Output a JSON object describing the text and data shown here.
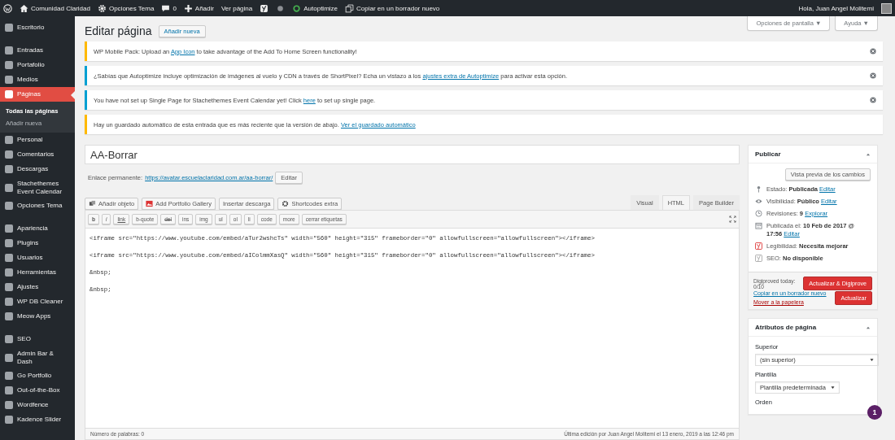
{
  "admin_bar": {
    "items": [
      {
        "kind": "logo"
      },
      {
        "kind": "home",
        "label": "Comunidad Claridad"
      },
      {
        "kind": "settings",
        "label": "Opciones Tema"
      },
      {
        "kind": "comments",
        "label": "0"
      },
      {
        "kind": "new",
        "label": "Añadir"
      },
      {
        "kind": "link",
        "label": "Ver página"
      },
      {
        "kind": "seo"
      },
      {
        "kind": "dot"
      },
      {
        "kind": "ring",
        "label": "Autoptimize"
      },
      {
        "kind": "copy",
        "label": "Copiar en un borrador nuevo"
      }
    ],
    "user": "Hola, Juan Angel Molitemi"
  },
  "sidebar": {
    "groups": [
      [
        {
          "label": "Escritorio",
          "selected": false
        }
      ],
      [
        {
          "label": "Entradas",
          "selected": false
        },
        {
          "label": "Portafolio",
          "selected": false
        },
        {
          "label": "Medios",
          "selected": false
        },
        {
          "label": "Páginas",
          "selected": true,
          "children": [
            {
              "label": "Todas las páginas",
              "selected": true
            },
            {
              "label": "Añadir nueva",
              "selected": false
            }
          ]
        },
        {
          "label": "Personal",
          "selected": false
        },
        {
          "label": "Comentarios",
          "selected": false
        },
        {
          "label": "Descargas",
          "selected": false
        },
        {
          "label": "Stachethemes Event Calendar",
          "selected": false
        },
        {
          "label": "Opciones Tema",
          "selected": false
        }
      ],
      [
        {
          "label": "Apariencia",
          "selected": false
        },
        {
          "label": "Plugins",
          "selected": false
        },
        {
          "label": "Usuarios",
          "selected": false
        },
        {
          "label": "Herramientas",
          "selected": false
        },
        {
          "label": "Ajustes",
          "selected": false
        },
        {
          "label": "WP DB Cleaner",
          "selected": false
        },
        {
          "label": "Meow Apps",
          "selected": false
        }
      ],
      [
        {
          "label": "SEO",
          "selected": false
        },
        {
          "label": "Admin Bar & Dash",
          "selected": false
        },
        {
          "label": "Go Portfolio",
          "selected": false
        },
        {
          "label": "Out-of-the-Box",
          "selected": false
        },
        {
          "label": "Wordfence",
          "selected": false
        },
        {
          "label": "Kadence Slider",
          "selected": false
        }
      ]
    ]
  },
  "header": {
    "title": "Editar página",
    "add_button": "Añadir nueva",
    "screen_options": "Opciones de pantalla ▼",
    "help": "Ayuda ▼"
  },
  "notices": [
    {
      "color": "#ffb900",
      "text_before": "WP Mobile Pack: Upload an ",
      "link": "App Icon",
      "text_after": " to take advantage of the Add To Home Screen functionality!",
      "dismissible": true
    },
    {
      "color": "#00a0d2",
      "text_before": "¿Sabías que Autoptimize incluye optimización de imágenes al vuelo y CDN a través de ShortPixel? Echa un vistazo a los ",
      "link": "ajustes extra de Autoptimize",
      "text_after": " para activar esta opción.",
      "dismissible": true
    },
    {
      "color": "#00a0d2",
      "text_before": "You have not set up Single Page for Stachethemes Event Calendar yet! Click ",
      "link": "here",
      "text_after": " to set up single page.",
      "dismissible": true
    },
    {
      "color": "#ffb900",
      "text_before": "Hay un guardado automático de esta entrada que es más reciente que la versión de abajo. ",
      "link": "Ver el guardado automático",
      "dismissible": false
    }
  ],
  "editor": {
    "title": "AA-Borrar",
    "permalink_label": "Enlace permanente:",
    "permalink": "https://avatar.escuelaclaridad.com.ar/aa-borrar/",
    "permalink_edit": "Editar",
    "media_buttons": [
      {
        "kind": "media",
        "label": "Añadir objeto"
      },
      {
        "kind": "gallery",
        "label": "Add Portfolio Gallery"
      },
      {
        "kind": "plain",
        "label": "Insertar descarga"
      },
      {
        "kind": "shortcodes",
        "label": "Shortcodes extra"
      }
    ],
    "tabs": [
      {
        "label": "Visual",
        "selected": false
      },
      {
        "label": "HTML",
        "selected": true
      },
      {
        "label": "Page Builder",
        "selected": false
      }
    ],
    "quicktags": [
      {
        "label": "b",
        "kind": "bold"
      },
      {
        "label": "i",
        "kind": "italic"
      },
      {
        "label": "link",
        "kind": "link"
      },
      {
        "label": "b-quote",
        "kind": "plain"
      },
      {
        "label": "del",
        "kind": "strike"
      },
      {
        "label": "ins",
        "kind": "plain"
      },
      {
        "label": "img",
        "kind": "plain"
      },
      {
        "label": "ul",
        "kind": "plain"
      },
      {
        "label": "ol",
        "kind": "plain"
      },
      {
        "label": "li",
        "kind": "plain"
      },
      {
        "label": "code",
        "kind": "plain"
      },
      {
        "label": "more",
        "kind": "plain"
      },
      {
        "label": "cerrar etiquetas",
        "kind": "plain"
      }
    ],
    "content": [
      "<iframe src=\"https://www.youtube.com/embed/aTur2wshcTs\" width=\"560\" height=\"315\" frameborder=\"0\" allowfullscreen=\"allowfullscreen\"></iframe>",
      "<iframe src=\"https://www.youtube.com/embed/aIColmmXasQ\" width=\"560\" height=\"315\" frameborder=\"0\" allowfullscreen=\"allowfullscreen\"></iframe>",
      "&nbsp;",
      "&nbsp;"
    ],
    "word_count": "Número de palabras: 0",
    "last_edit": "Última edición por Juan Angel Molitemi el 13 enero, 2019 a las 12:46 pm"
  },
  "publish": {
    "title": "Publicar",
    "preview": "Vista previa de los cambios",
    "rows": [
      {
        "kind": "status",
        "text": "Estado: **Publicada**",
        "link": "Editar"
      },
      {
        "kind": "visibility",
        "text": "Visibilidad: **Público**",
        "link": "Editar"
      },
      {
        "kind": "revisions",
        "text": "Revisiones: **9**",
        "link": "Explorar"
      },
      {
        "kind": "date",
        "text": "Publicada el: **10 Feb de 2017 @ 17:56**",
        "link": "Editar"
      },
      {
        "kind": "readability",
        "text": "Legibilidad: **Necesita mejorar**"
      },
      {
        "kind": "seo",
        "text": "SEO: **No disponible**"
      }
    ],
    "digiproved": "Digiproved today: 0/10",
    "digiprove_button": "Actualizar & Digiprove",
    "copy_link": "Copiar en un borrador nuevo",
    "trash_link": "Mover a la papelera",
    "update_button": "Actualizar"
  },
  "attributes": {
    "title": "Atributos de página",
    "parent_label": "Superior",
    "parent_value": "(sin superior)",
    "template_label": "Plantilla",
    "template_value": "Plantilla predeterminada",
    "order_label": "Orden"
  },
  "badge": "1"
}
